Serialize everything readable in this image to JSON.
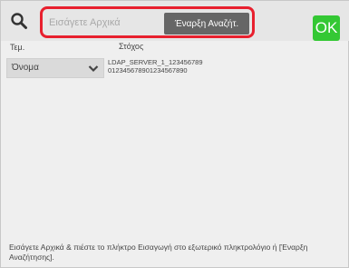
{
  "search": {
    "placeholder": "Εισάγετε Αρχικά",
    "start_button_label": "Έναρξη Αναζήτ.",
    "ok_label": "OK"
  },
  "form": {
    "item_label": "Τεμ.",
    "destination_label": "Στόχος",
    "selected_item": "Όνομα"
  },
  "server": {
    "name": "LDAP_SERVER_1_123456789",
    "number": "012345678901234567890"
  },
  "hint": "Εισάγετε Αρχικά & πιέστε το πλήκτρο Εισαγωγή στο εξωτερικό πληκτρολόγιο ή [Έναρξη Αναζήτησης].",
  "colors": {
    "highlight": "#e8202e",
    "ok_button": "#34c834",
    "start_button": "#666666"
  }
}
